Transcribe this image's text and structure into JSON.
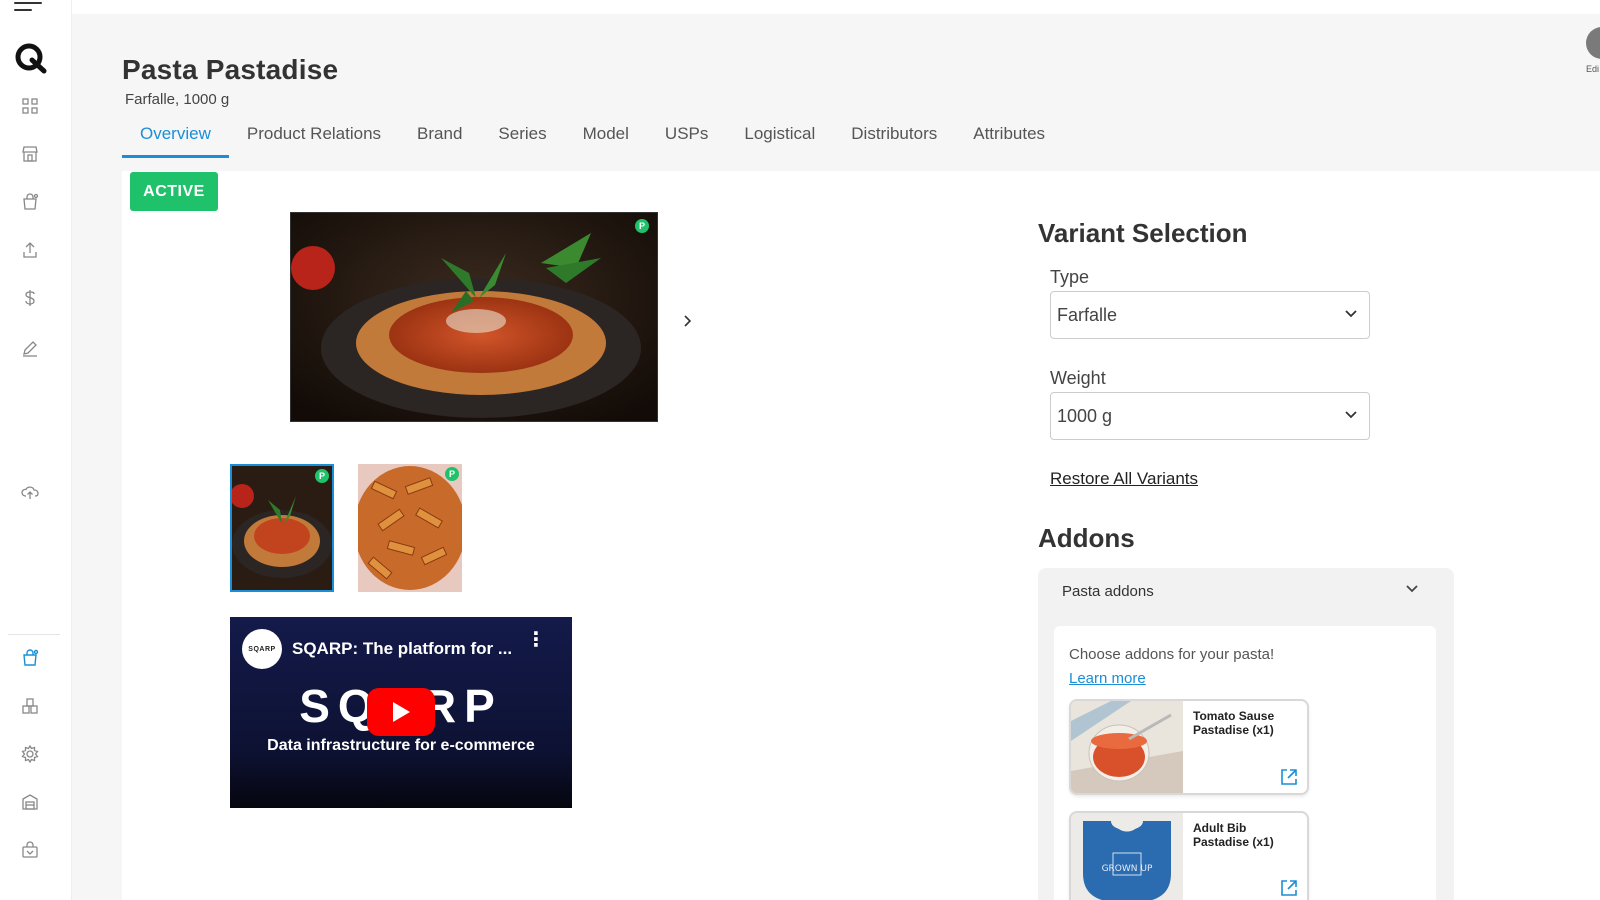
{
  "product": {
    "title": "Pasta Pastadise",
    "subtitle": "Farfalle, 1000 g",
    "status": "ACTIVE"
  },
  "tabs": [
    {
      "label": "Overview",
      "active": true
    },
    {
      "label": "Product Relations"
    },
    {
      "label": "Brand"
    },
    {
      "label": "Series"
    },
    {
      "label": "Model"
    },
    {
      "label": "USPs"
    },
    {
      "label": "Logistical"
    },
    {
      "label": "Distributors"
    },
    {
      "label": "Attributes"
    }
  ],
  "user": {
    "label": "Edi"
  },
  "media": {
    "image_badge": "P",
    "video": {
      "channel": "SQARP",
      "title": "SQARP: The platform for ...",
      "brand": "SQARP",
      "tagline": "Data infrastructure for e-commerce"
    }
  },
  "variant_selection": {
    "title": "Variant Selection",
    "type_label": "Type",
    "type_value": "Farfalle",
    "weight_label": "Weight",
    "weight_value": "1000 g",
    "restore_label": "Restore All Variants"
  },
  "addons": {
    "title": "Addons",
    "group_label": "Pasta addons",
    "description": "Choose addons for your pasta!",
    "learn_more": "Learn more",
    "items": [
      {
        "name": "Tomato Sause Pastadise (x1)"
      },
      {
        "name": "Adult Bib Pastadise (x1)",
        "image_text": "GROWN UP"
      }
    ]
  },
  "colors": {
    "accent": "#1a8fd6",
    "active": "#1fc26b"
  },
  "icons": [
    "menu-icon",
    "logo-icon",
    "dashboard-icon",
    "store-icon",
    "product-icon",
    "upload-icon",
    "dollar-icon",
    "edit-icon",
    "cloud-icon",
    "product-icon",
    "bundle-icon",
    "settings-icon",
    "warehouse-icon",
    "bag-icon"
  ]
}
